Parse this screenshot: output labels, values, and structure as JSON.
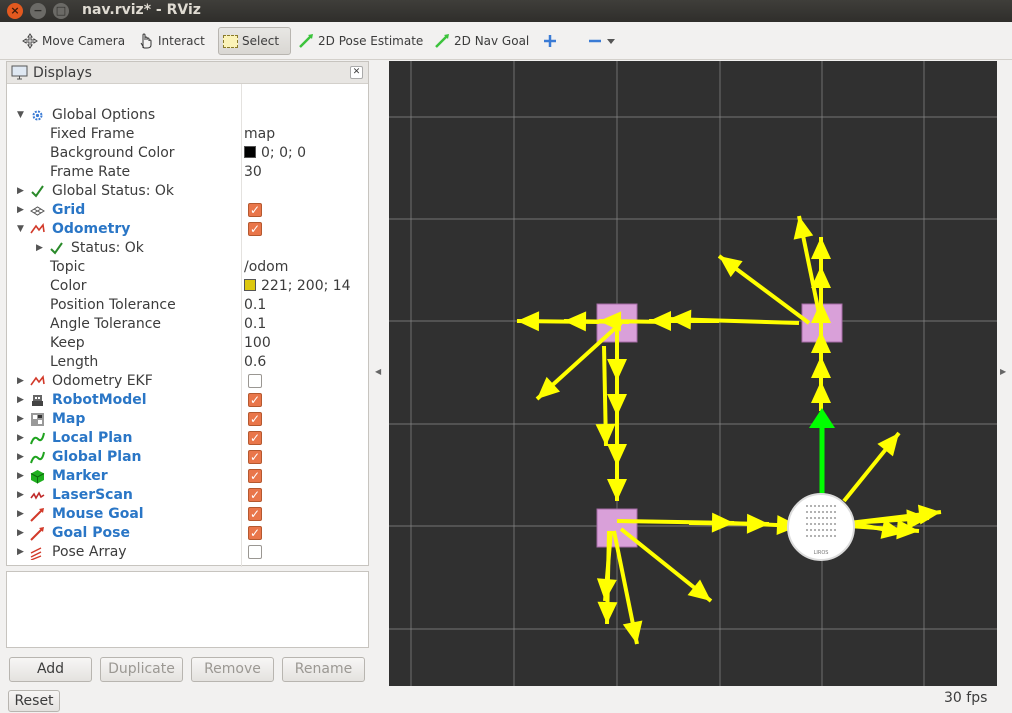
{
  "window": {
    "title": "nav.rviz* - RViz",
    "close": "×",
    "minimize": "−",
    "maximize": "□"
  },
  "toolbar": {
    "move_camera": "Move Camera",
    "interact": "Interact",
    "select": "Select",
    "pose_estimate": "2D Pose Estimate",
    "nav_goal": "2D Nav Goal"
  },
  "displays": {
    "title": "Displays",
    "rows": [
      {
        "name": "Global Options",
        "value": ""
      },
      {
        "name": "Fixed Frame",
        "value": "map"
      },
      {
        "name": "Background Color",
        "value": "0; 0; 0"
      },
      {
        "name": "Frame Rate",
        "value": "30"
      },
      {
        "name": "Global Status: Ok",
        "value": ""
      },
      {
        "name": "Grid",
        "value": ""
      },
      {
        "name": "Odometry",
        "value": ""
      },
      {
        "name": "Status: Ok",
        "value": ""
      },
      {
        "name": "Topic",
        "value": "/odom"
      },
      {
        "name": "Color",
        "value": "221; 200; 14"
      },
      {
        "name": "Position Tolerance",
        "value": "0.1"
      },
      {
        "name": "Angle Tolerance",
        "value": "0.1"
      },
      {
        "name": "Keep",
        "value": "100"
      },
      {
        "name": "Length",
        "value": "0.6"
      },
      {
        "name": "Odometry EKF",
        "value": ""
      },
      {
        "name": "RobotModel",
        "value": ""
      },
      {
        "name": "Map",
        "value": ""
      },
      {
        "name": "Local Plan",
        "value": ""
      },
      {
        "name": "Global Plan",
        "value": ""
      },
      {
        "name": "Marker",
        "value": ""
      },
      {
        "name": "LaserScan",
        "value": ""
      },
      {
        "name": "Mouse Goal",
        "value": ""
      },
      {
        "name": "Goal Pose",
        "value": ""
      },
      {
        "name": "Pose Array",
        "value": ""
      }
    ],
    "checks": {
      "grid": true,
      "odometry": true,
      "odometry_ekf": false,
      "robotmodel": true,
      "map": true,
      "local_plan": true,
      "global_plan": true,
      "marker": true,
      "laserscan": true,
      "mouse_goal": true,
      "goal_pose": true,
      "pose_array": false
    },
    "colors": {
      "background": "#000000",
      "odometry": "#ddc80e"
    }
  },
  "buttons": {
    "add": "Add",
    "duplicate": "Duplicate",
    "remove": "Remove",
    "rename": "Rename",
    "reset": "Reset"
  },
  "status": {
    "fps": "30 fps"
  },
  "scene": {
    "colors": {
      "background": "#303030",
      "grid": "#8a8a8a",
      "arrow": "#ffff00",
      "box": "#d9a0d9",
      "pose": "#00ff00"
    },
    "robot_logo": "LIROS"
  }
}
